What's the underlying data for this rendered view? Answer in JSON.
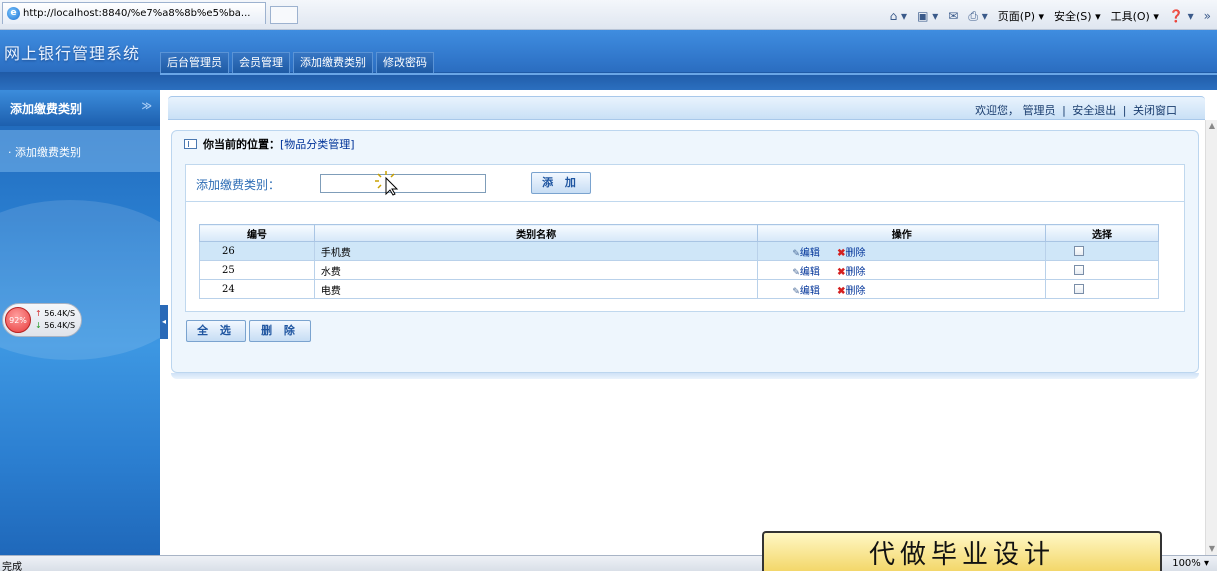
{
  "browser": {
    "url": "http://localhost:8840/%e7%a8%8b%e5%ba...",
    "commands": [
      "页面(P) ▾",
      "安全(S) ▾",
      "工具(O) ▾"
    ],
    "home_glyph": "⌂ ▾",
    "feed_glyph": "▣ ▾",
    "mail_glyph": "✉",
    "print_glyph": "⎙ ▾",
    "help_glyph": "❓ ▾",
    "more_glyph": "»"
  },
  "app": {
    "title": "网上银行管理系统",
    "nav": [
      "后台管理员",
      "会员管理",
      "添加缴费类别",
      "修改密码"
    ]
  },
  "sidebar": {
    "header": "添加缴费类别",
    "chevron": "≫",
    "items": [
      {
        "label": "· 添加缴费类别"
      }
    ]
  },
  "netspeed": {
    "percent": "92%",
    "up": "56.4K/S",
    "down": "56.4K/S",
    "up_arrow": "↑",
    "down_arrow": "↓"
  },
  "topbar": {
    "welcome": "欢迎您，",
    "user": "管理员",
    "logout": "安全退出",
    "close": "关闭窗口",
    "separator": "|"
  },
  "breadcrumb": {
    "label": "你当前的位置：",
    "value": "[物品分类管理]"
  },
  "form": {
    "label": "添加缴费类别：",
    "input_value": "",
    "add_button": "添 加"
  },
  "table": {
    "headers": [
      "编号",
      "类别名称",
      "操作",
      "选择"
    ],
    "rows": [
      {
        "id": "26",
        "name": "手机费",
        "edit": "编辑",
        "delete": "删除",
        "highlighted": true
      },
      {
        "id": "25",
        "name": "水费",
        "edit": "编辑",
        "delete": "删除",
        "highlighted": false
      },
      {
        "id": "24",
        "name": "电费",
        "edit": "编辑",
        "delete": "删除",
        "highlighted": false
      }
    ]
  },
  "actions": {
    "select_all": "全 选",
    "delete": "删 除"
  },
  "status": {
    "text": "完成",
    "zoom": "100% ▾"
  },
  "overlay": {
    "text": "代做毕业设计"
  },
  "colors": {
    "header_blue": "#2f74c8",
    "link": "#003399",
    "highlight_row": "#cfe6f8",
    "delete_x": "#d42020"
  }
}
